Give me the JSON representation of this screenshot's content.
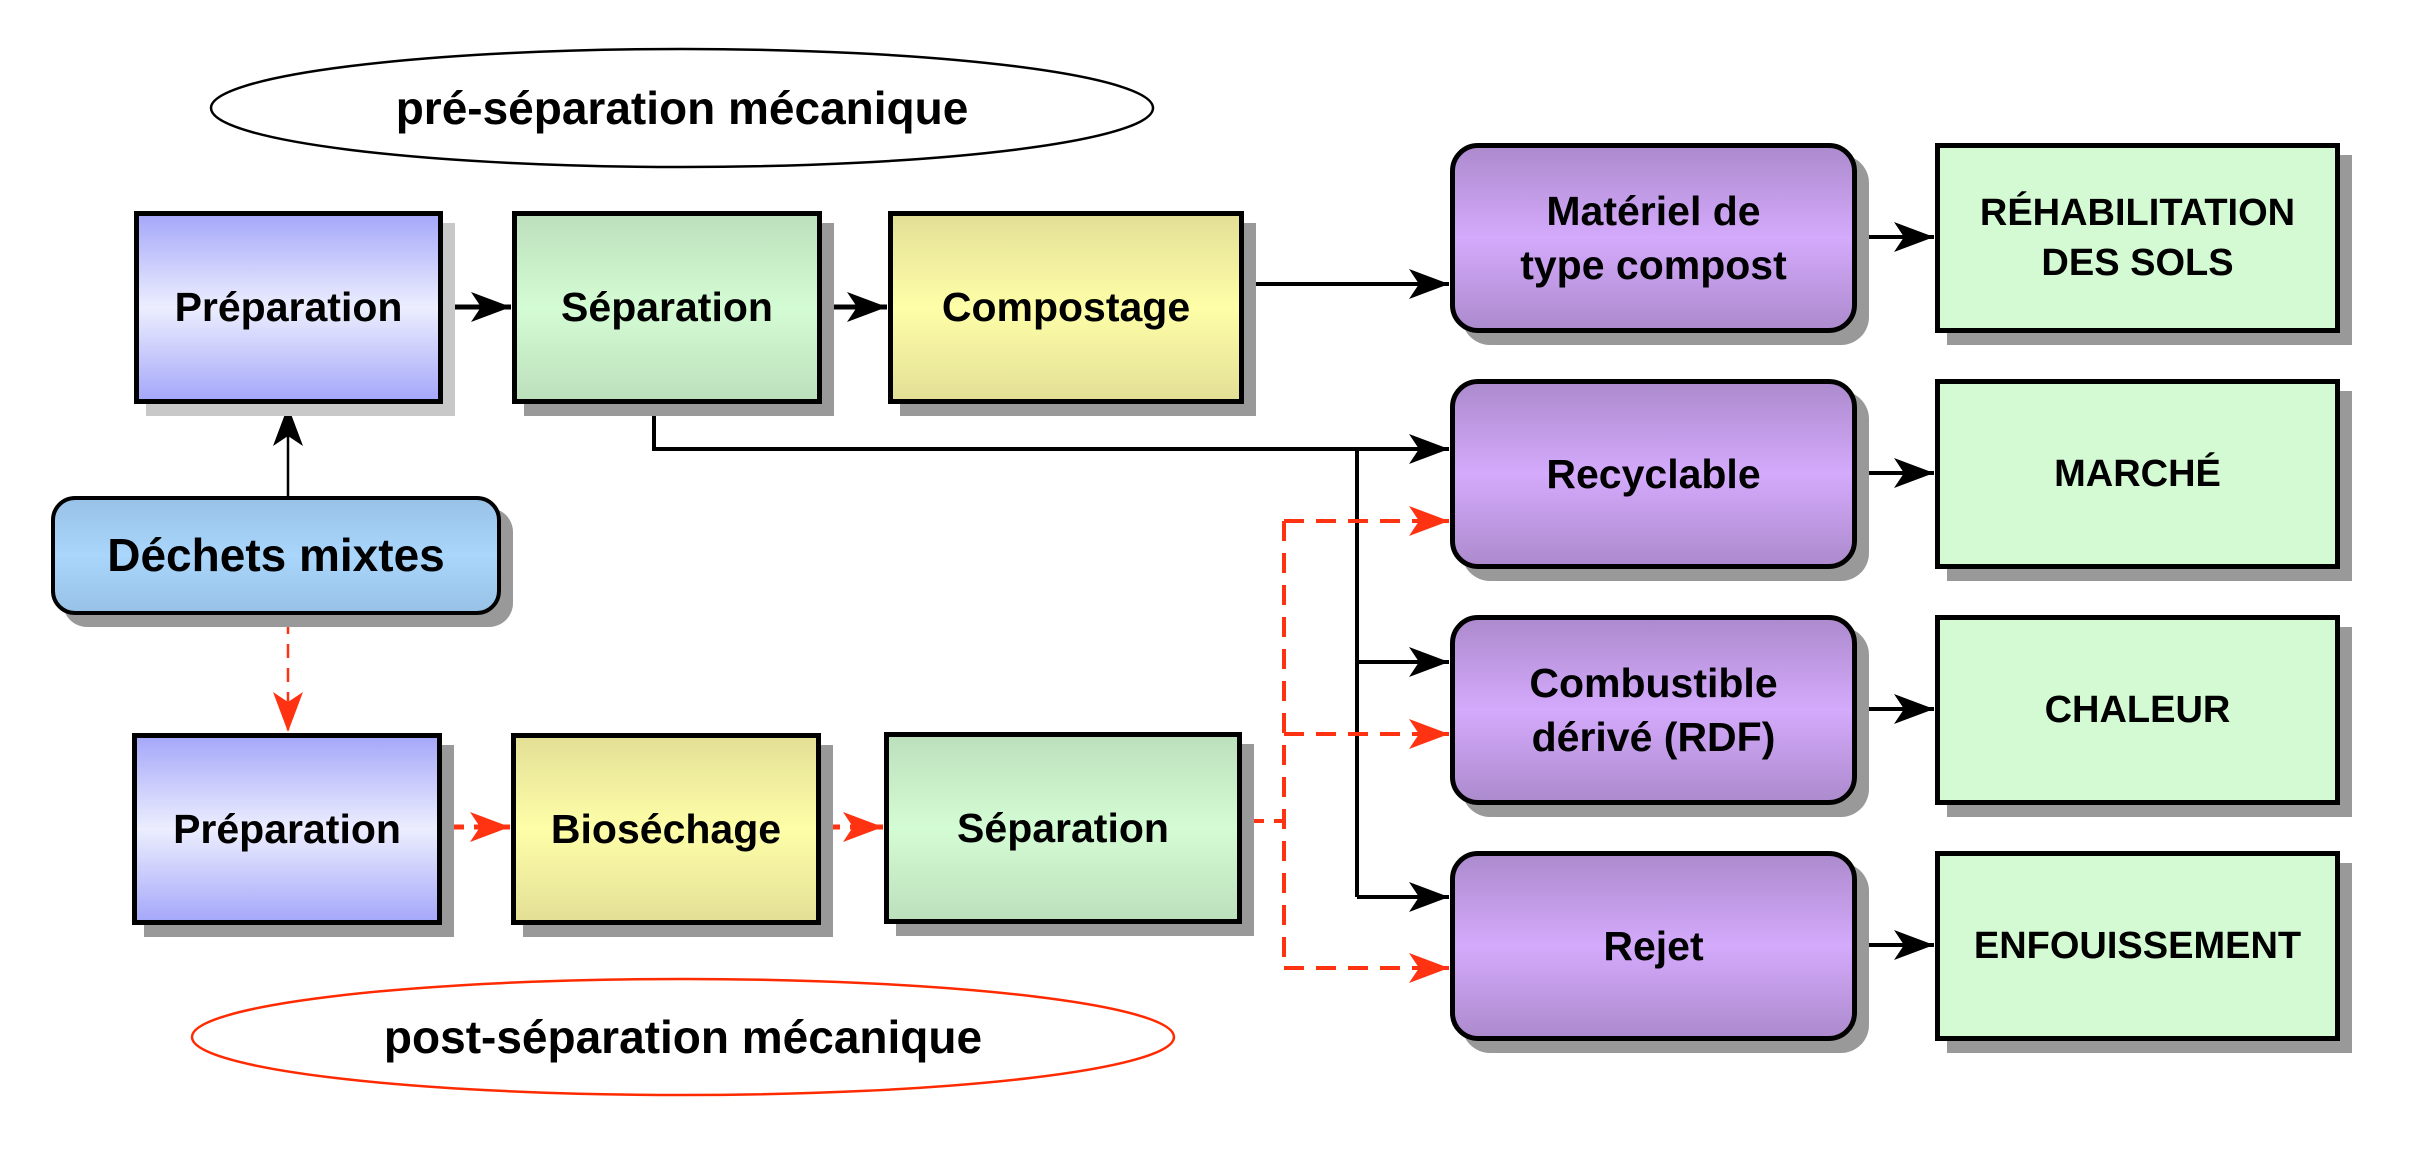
{
  "diagram": {
    "title": "",
    "colors": {
      "black_flow": "#000000",
      "red_flow": "#ff3311",
      "post_oval_stroke": "#ff2a00",
      "pre_oval_stroke": "#000000"
    },
    "ovals": {
      "pre": "pré-séparation mécanique",
      "post": "post-séparation mécanique"
    },
    "source": {
      "label": "Déchets mixtes"
    },
    "pre_route": {
      "steps": [
        {
          "id": "pre_prep",
          "label": "Préparation"
        },
        {
          "id": "pre_sep",
          "label": "Séparation"
        },
        {
          "id": "pre_comp",
          "label": "Compostage"
        }
      ]
    },
    "post_route": {
      "steps": [
        {
          "id": "post_prep",
          "label": "Préparation"
        },
        {
          "id": "post_bio",
          "label": "Bioséchage"
        },
        {
          "id": "post_sep",
          "label": "Séparation"
        }
      ]
    },
    "products": [
      {
        "id": "prod_compost",
        "label": "Matériel de\ntype compost",
        "outcome": "RÉHABILITATION\nDES SOLS"
      },
      {
        "id": "prod_recycl",
        "label": "Recyclable",
        "outcome": "MARCHÉ"
      },
      {
        "id": "prod_rdf",
        "label": "Combustible\ndérivé (RDF)",
        "outcome": "CHALEUR"
      },
      {
        "id": "prod_rejet",
        "label": "Rejet",
        "outcome": "ENFOUISSEMENT"
      }
    ],
    "connections": [
      {
        "from": "Déchets mixtes",
        "to": "Préparation (pré)",
        "style": "solid"
      },
      {
        "from": "Préparation (pré)",
        "to": "Séparation (pré)",
        "style": "solid"
      },
      {
        "from": "Séparation (pré)",
        "to": "Compostage",
        "style": "solid"
      },
      {
        "from": "Compostage",
        "to": "Matériel de type compost",
        "style": "solid"
      },
      {
        "from": "Séparation (pré)",
        "to": "Recyclable",
        "style": "solid"
      },
      {
        "from": "Séparation (pré)",
        "to": "Combustible dérivé (RDF)",
        "style": "solid"
      },
      {
        "from": "Séparation (pré)",
        "to": "Rejet",
        "style": "solid"
      },
      {
        "from": "Déchets mixtes",
        "to": "Préparation (post)",
        "style": "dashed-red"
      },
      {
        "from": "Préparation (post)",
        "to": "Bioséchage",
        "style": "dashed-red"
      },
      {
        "from": "Bioséchage",
        "to": "Séparation (post)",
        "style": "dashed-red"
      },
      {
        "from": "Séparation (post)",
        "to": "Recyclable",
        "style": "dashed-red"
      },
      {
        "from": "Séparation (post)",
        "to": "Combustible dérivé (RDF)",
        "style": "dashed-red"
      },
      {
        "from": "Séparation (post)",
        "to": "Rejet",
        "style": "dashed-red"
      },
      {
        "from": "Matériel de type compost",
        "to": "RÉHABILITATION DES SOLS",
        "style": "solid"
      },
      {
        "from": "Recyclable",
        "to": "MARCHÉ",
        "style": "solid"
      },
      {
        "from": "Combustible dérivé (RDF)",
        "to": "CHALEUR",
        "style": "solid"
      },
      {
        "from": "Rejet",
        "to": "ENFOUISSEMENT",
        "style": "solid"
      }
    ]
  }
}
